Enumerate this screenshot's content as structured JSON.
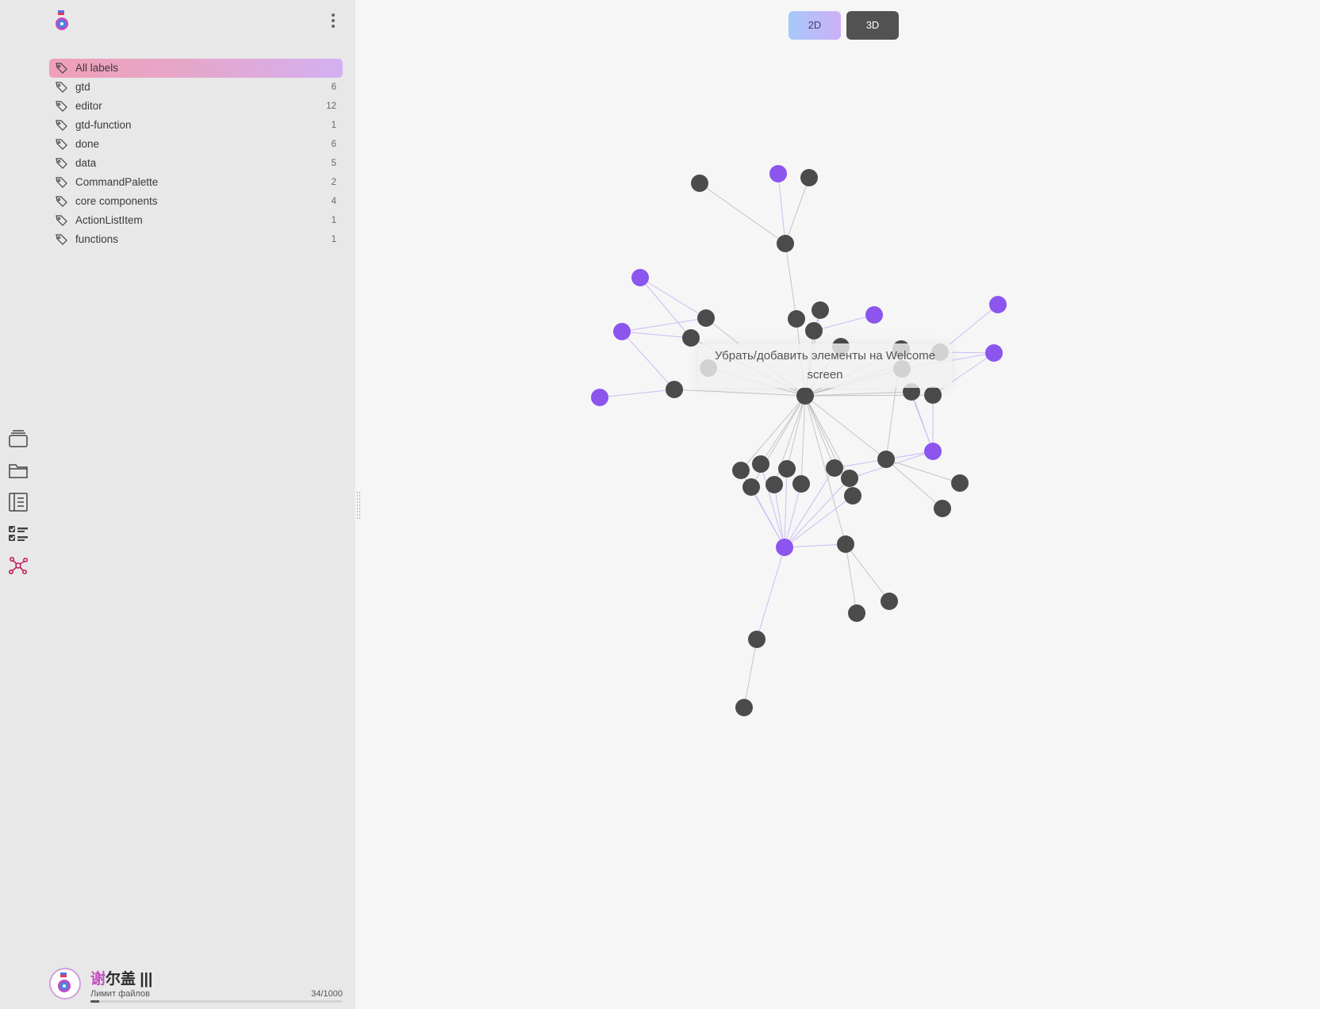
{
  "sidebar": {
    "labels": [
      {
        "name": "All labels",
        "count": "",
        "active": true
      },
      {
        "name": "gtd",
        "count": "6"
      },
      {
        "name": "editor",
        "count": "12"
      },
      {
        "name": "gtd-function",
        "count": "1"
      },
      {
        "name": "done",
        "count": "6"
      },
      {
        "name": "data",
        "count": "5"
      },
      {
        "name": "CommandPalette",
        "count": "2"
      },
      {
        "name": "core components",
        "count": "4"
      },
      {
        "name": "ActionListItem",
        "count": "1"
      },
      {
        "name": "functions",
        "count": "1"
      }
    ],
    "nav_icons": [
      "cards-icon",
      "folder-icon",
      "notebook-icon",
      "checklist-icon",
      "graph-icon"
    ],
    "active_nav": "graph-icon"
  },
  "user": {
    "name_part1": "谢",
    "name_part2": "尔盖",
    "name_part3": "|||",
    "limit_label": "Лимит файлов",
    "limit_value": "34/1000",
    "limit_fraction": 0.034
  },
  "view_toggle": {
    "label_2d": "2D",
    "label_3d": "3D",
    "active": "2D"
  },
  "graph": {
    "tooltip_line1": "Убрать/добавить элементы на Welcome",
    "tooltip_line2": "screen",
    "colors": {
      "note": "#4b4b4b",
      "label": "#8b55ee",
      "edge_gray": "#c4c4c4",
      "edge_purple": "#cbbcf4"
    }
  }
}
